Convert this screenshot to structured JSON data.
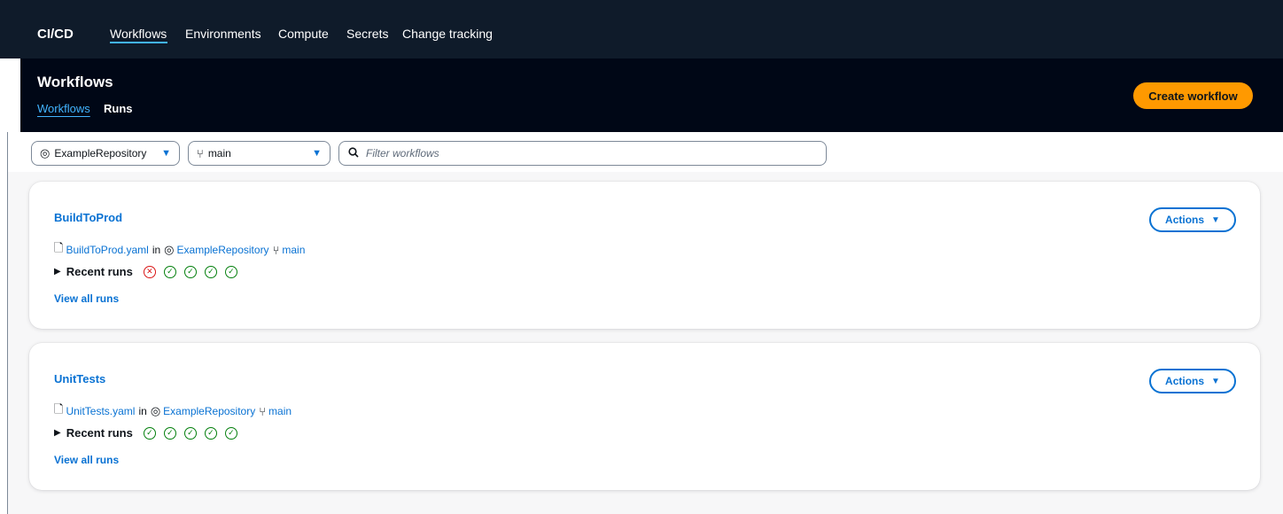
{
  "topnav": {
    "brand": "CI/CD",
    "links": [
      "Workflows",
      "Environments",
      "Compute",
      "Secrets",
      "Change tracking"
    ],
    "active_index": 0
  },
  "header": {
    "title": "Workflows",
    "subtabs": [
      "Workflows",
      "Runs"
    ],
    "create_button": "Create workflow"
  },
  "filters": {
    "repository": "ExampleRepository",
    "branch": "main",
    "search_placeholder": "Filter workflows"
  },
  "workflows": [
    {
      "name": "BuildToProd",
      "file": "BuildToProd.yaml",
      "in_label": "in",
      "repository": "ExampleRepository",
      "branch": "main",
      "recent_runs_label": "Recent runs",
      "recent_runs": [
        "failed",
        "succeeded",
        "succeeded",
        "succeeded",
        "succeeded"
      ],
      "view_all_label": "View all runs",
      "actions_label": "Actions"
    },
    {
      "name": "UnitTests",
      "file": "UnitTests.yaml",
      "in_label": "in",
      "repository": "ExampleRepository",
      "branch": "main",
      "recent_runs_label": "Recent runs",
      "recent_runs": [
        "succeeded",
        "succeeded",
        "succeeded",
        "succeeded",
        "succeeded"
      ],
      "view_all_label": "View all runs",
      "actions_label": "Actions"
    }
  ],
  "colors": {
    "nav_bg": "#0f1b2a",
    "header_bg": "#000716",
    "link": "#0972d3",
    "primary_button": "#ff9900",
    "success": "#037f0c",
    "error": "#d91515"
  },
  "icons": {
    "repository": "repository-icon",
    "branch": "branch-icon",
    "search": "search-icon",
    "file": "file-icon",
    "caret": "caret-down-icon",
    "expand": "expand-triangle-icon",
    "success": "status-success-icon",
    "failed": "status-failed-icon"
  }
}
